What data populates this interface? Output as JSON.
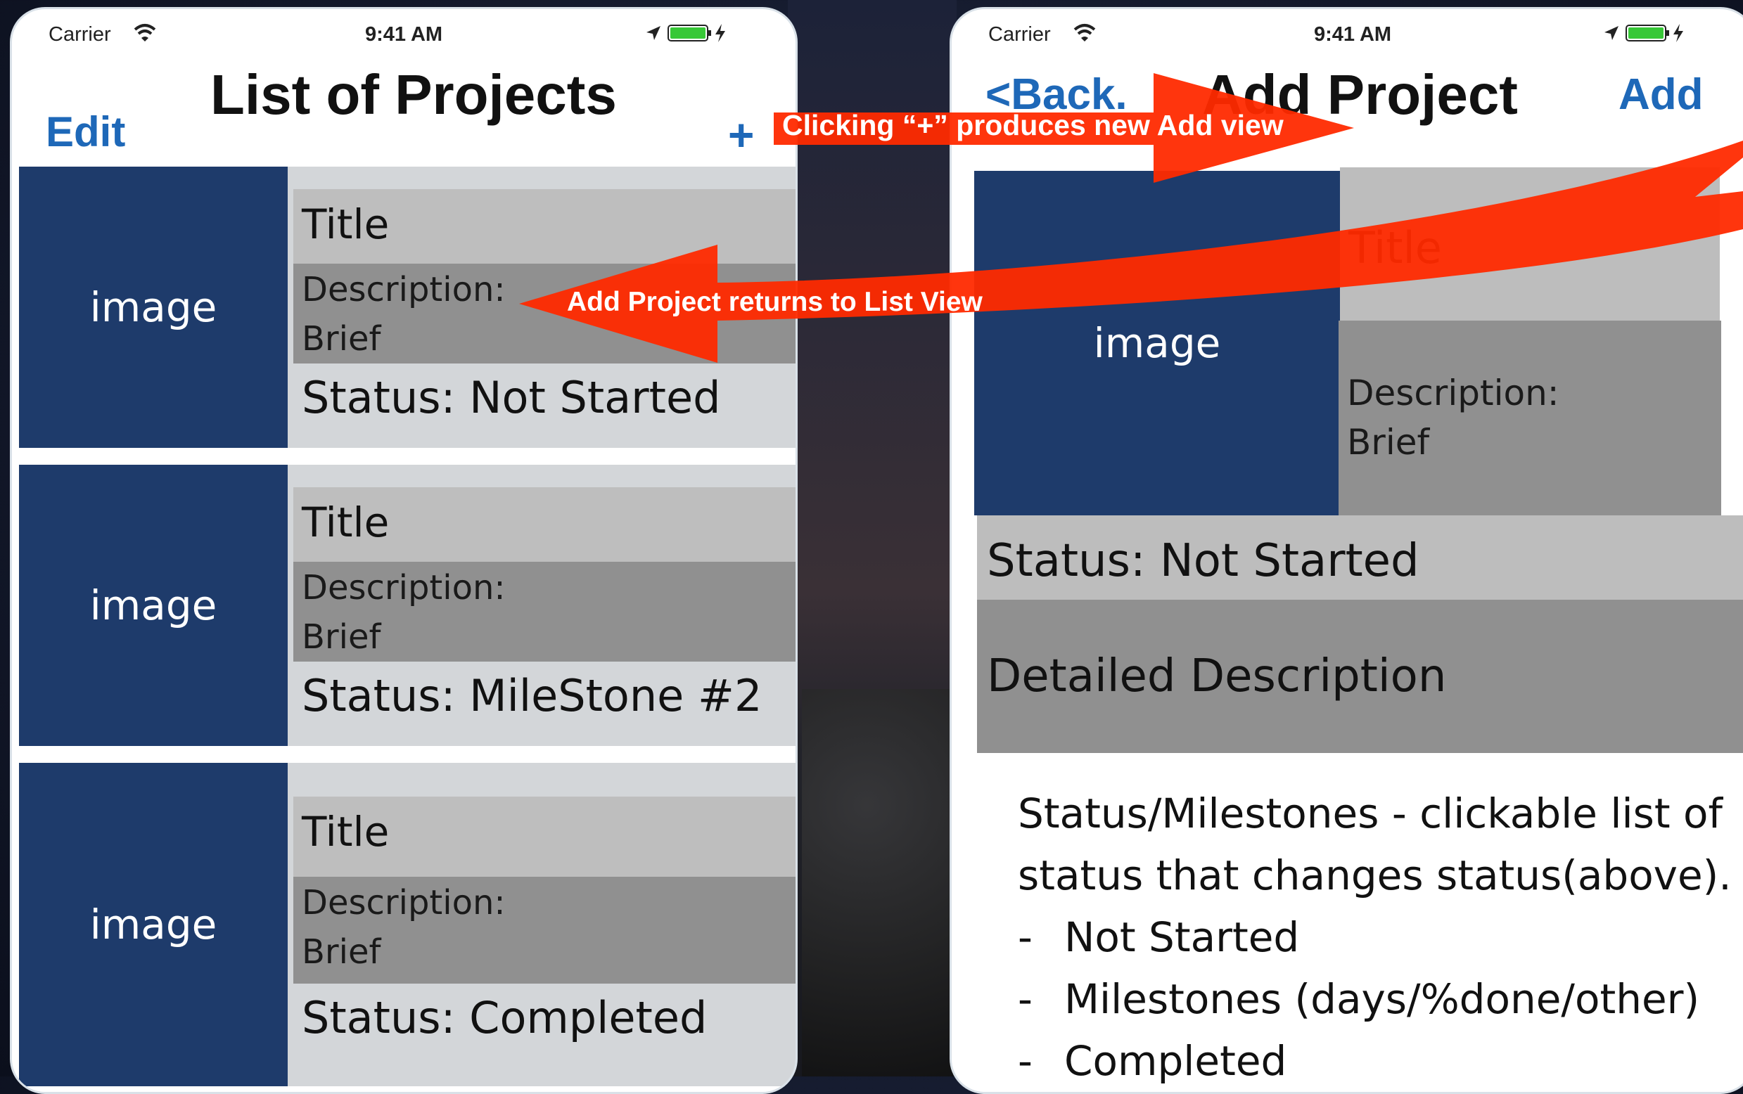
{
  "status_bar": {
    "carrier": "Carrier",
    "time": "9:41 AM"
  },
  "list_view": {
    "title": "List of Projects",
    "edit": "Edit",
    "add": "+",
    "rows": [
      {
        "image": "image",
        "title": "Title",
        "desc_label": "Description:",
        "desc_value": "Brief",
        "status": "Status: Not Started"
      },
      {
        "image": "image",
        "title": "Title",
        "desc_label": "Description:",
        "desc_value": "Brief",
        "status": "Status: MileStone #2"
      },
      {
        "image": "image",
        "title": "Title",
        "desc_label": "Description:",
        "desc_value": "Brief",
        "status": "Status: Completed"
      }
    ]
  },
  "add_view": {
    "back": "<Back.",
    "title": "Add Project",
    "add": "Add",
    "image": "image",
    "field_title": "Title",
    "desc_label": "Description:",
    "desc_value": "Brief",
    "status": "Status: Not Started",
    "detailed": "Detailed Description",
    "milestones_text_1": "Status/Milestones - clickable list of",
    "milestones_text_2": "status that changes status(above).",
    "list_dash": "-",
    "options": [
      "Not Started",
      "Milestones (days/%done/other)",
      "Completed"
    ]
  },
  "annotations": {
    "plus_to_add": "Clicking “+” produces new Add view",
    "add_to_list": "Add Project returns to List View"
  },
  "colors": {
    "accent": "#1e68b8",
    "tile": "#1e3b6b",
    "arrow": "#ff2a00"
  }
}
